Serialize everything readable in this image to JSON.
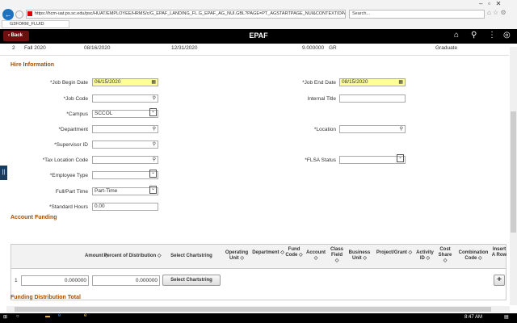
{
  "browser": {
    "url": "https://hcm-uat.ps.sc.edu/psc/HUAT/EMPLOYEE/HRMS/c/G_EPAF_LANDING_FL.G_EPAF_AG_NUI.GBL?PAGE=PT_AGSTARTPAGE_NUI&CONTEXTIDPARAM",
    "search_placeholder": "Search...",
    "tab_title": "G3FORM_FLUID"
  },
  "header": {
    "back_label": "Back",
    "title": "EPAF",
    "icons": [
      "home-icon",
      "search-icon",
      "more-vertical-icon",
      "compass-icon"
    ]
  },
  "term_row": {
    "num": "2",
    "term": "Fall 2020",
    "start": "08/16/2020",
    "end": "12/31/2020",
    "units": "9.000000",
    "code": "GR",
    "career": "Graduate"
  },
  "hire": {
    "section_title": "Hire Information",
    "job_begin_label": "*Job Begin Date",
    "job_begin": "06/15/2020",
    "job_end_label": "*Job End Date",
    "job_end": "08/15/2020",
    "job_code_label": "*Job Code",
    "job_code": "",
    "internal_title_label": "Internal Title",
    "internal_title": "",
    "campus_label": "*Campus",
    "campus": "SCCOL",
    "department_label": "*Department",
    "department": "",
    "location_label": "*Location",
    "location": "",
    "supervisor_label": "*Supervisor ID",
    "supervisor": "",
    "tax_location_label": "*Tax Location Code",
    "tax_location": "",
    "flsa_label": "*FLSA Status",
    "flsa": "",
    "employee_type_label": "*Employee Type",
    "employee_type": "",
    "full_part_label": "Full/Part Time",
    "full_part": "Part-Time",
    "std_hours_label": "*Standard Hours",
    "std_hours": "0.00"
  },
  "funding": {
    "section_title": "Account Funding",
    "columns": [
      "Amount ◇",
      "Percent of Distribution ◇",
      "Select Chartstring",
      "Operating Unit ◇",
      "Department ◇",
      "Fund Code ◇",
      "Account ◇",
      "Class Field ◇",
      "Business Unit ◇",
      "Project/Grant ◇",
      "Activity ID ◇",
      "Cost Share ◇",
      "Combination Code ◇",
      "Insert A Row"
    ],
    "row": {
      "num": "1",
      "amount": "0.000000",
      "percent": "0.000000",
      "select_label": "Select Chartstring"
    },
    "total_title": "Funding Distribution Total"
  },
  "taskbar": {
    "time": "8:47 AM"
  }
}
